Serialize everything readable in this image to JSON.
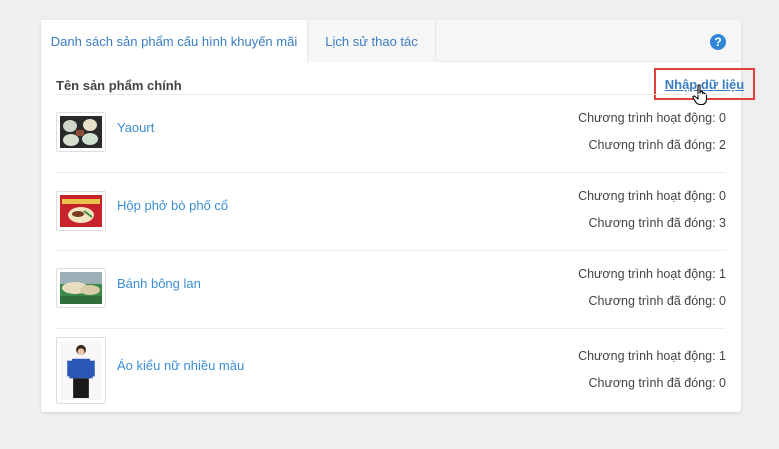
{
  "tabs": [
    {
      "label": "Danh sách sản phẩm cấu hình khuyến mãi",
      "active": true
    },
    {
      "label": "Lịch sử thao tác",
      "active": false
    }
  ],
  "help_icon": "question-circle-icon",
  "header": {
    "title": "Tên sản phẩm chính",
    "import_label": "Nhập dữ liệu"
  },
  "colors": {
    "accent": "#3b7dc3",
    "highlight_border": "#e0413b",
    "help": "#2f86d6"
  },
  "products": [
    {
      "name": "Yaourt",
      "active_label": "Chương trình hoạt động: 0",
      "closed_label": "Chương trình đã đóng: 2"
    },
    {
      "name": "Hộp phở bò phố cổ",
      "active_label": "Chương trình hoạt động: 0",
      "closed_label": "Chương trình đã đóng: 3"
    },
    {
      "name": "Bánh bông lan",
      "active_label": "Chương trình hoạt động: 1",
      "closed_label": "Chương trình đã đóng: 0"
    },
    {
      "name": "Áo kiểu nữ nhiều màu",
      "active_label": "Chương trình hoạt động: 1",
      "closed_label": "Chương trình đã đóng: 0"
    }
  ]
}
